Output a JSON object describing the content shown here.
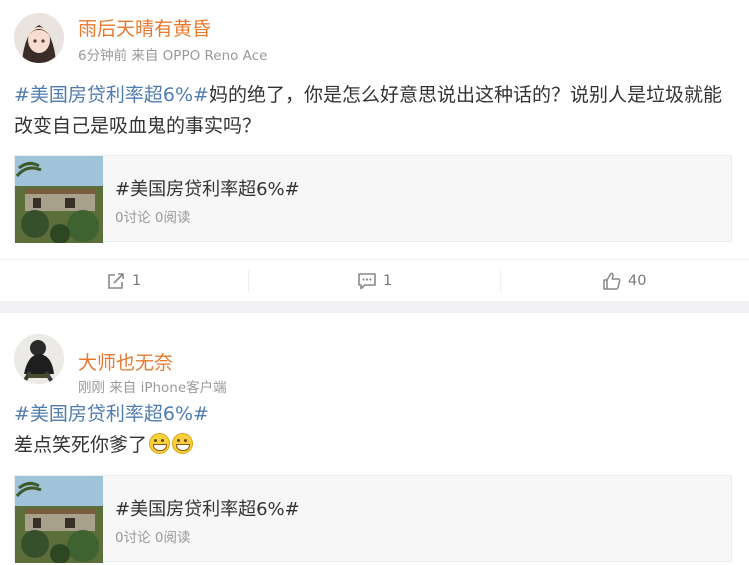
{
  "posts": [
    {
      "username": "雨后天晴有黄昏",
      "meta": "6分钟前 来自 OPPO Reno Ace",
      "hashtag": "#美国房贷利率超6%#",
      "text": "妈的绝了，你是怎么好意思说出这种话的？说别人是垃圾就能改变自己是吸血鬼的事实吗？",
      "card": {
        "title": "#美国房贷利率超6%#",
        "stats": "0讨论 0阅读"
      },
      "actions": {
        "share_count": "1",
        "comment_count": "1",
        "like_count": "40"
      }
    },
    {
      "username": "大师也无奈",
      "meta": "刚刚 来自 iPhone客户端",
      "hashtag": "#美国房贷利率超6%#",
      "text": "差点笑死你爹了",
      "card": {
        "title": "#美国房贷利率超6%#",
        "stats": "0讨论 0阅读"
      }
    }
  ],
  "icons": {
    "share": "share-icon",
    "comment": "comment-icon",
    "like": "thumbs-up-icon",
    "emoji": "grin-emoji"
  },
  "colors": {
    "username": "#e8792f",
    "hashtag": "#507daf",
    "meta": "#999999"
  }
}
